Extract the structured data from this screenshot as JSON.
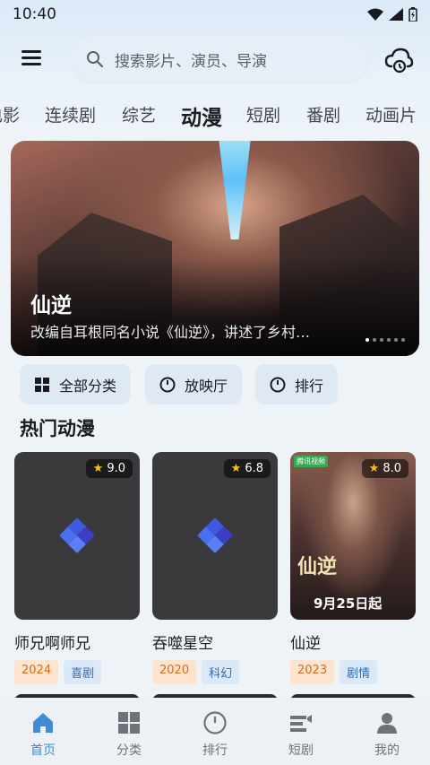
{
  "status": {
    "time": "10:40"
  },
  "search": {
    "placeholder": "搜索影片、演员、导演"
  },
  "tabs": [
    {
      "label": "电影"
    },
    {
      "label": "连续剧"
    },
    {
      "label": "综艺"
    },
    {
      "label": "动漫"
    },
    {
      "label": "短剧"
    },
    {
      "label": "番剧"
    },
    {
      "label": "动画片"
    }
  ],
  "active_tab": "动漫",
  "banner": {
    "title": "仙逆",
    "desc": "改编自耳根同名小说《仙逆》，讲述了乡村…"
  },
  "chips": [
    {
      "label": "全部分类",
      "icon": "grid-icon"
    },
    {
      "label": "放映厅",
      "icon": "circle-icon"
    },
    {
      "label": "排行",
      "icon": "circle-icon"
    }
  ],
  "section": {
    "title": "热门动漫"
  },
  "cards": [
    {
      "title": "师兄啊师兄",
      "rating": "9.0",
      "year": "2024",
      "genre": "喜剧"
    },
    {
      "title": "吞噬星空",
      "rating": "6.8",
      "year": "2020",
      "genre": "科幻"
    },
    {
      "title": "仙逆",
      "rating": "8.0",
      "year": "2023",
      "genre": "剧情",
      "poster_text": "仙逆",
      "poster_date": "9月25日起",
      "badge": "腾讯视频"
    }
  ],
  "nav": [
    {
      "label": "首页",
      "icon": "home-icon"
    },
    {
      "label": "分类",
      "icon": "grid-icon"
    },
    {
      "label": "排行",
      "icon": "circle-icon"
    },
    {
      "label": "短剧",
      "icon": "short-video-icon"
    },
    {
      "label": "我的",
      "icon": "user-icon"
    }
  ],
  "colors": {
    "accent": "#3f8bd6",
    "year_tag": "#d86a18",
    "genre_tag": "#2d6db5",
    "star": "#ffc107"
  }
}
